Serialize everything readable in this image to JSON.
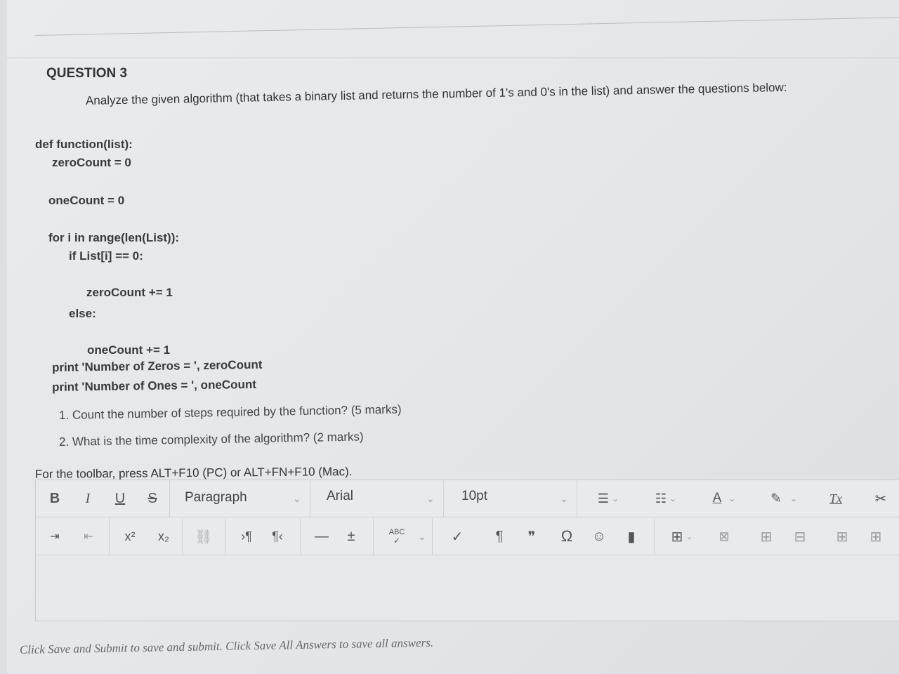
{
  "question": {
    "title": "QUESTION 3",
    "intro": "Analyze the given algorithm (that takes a binary list and returns the number of 1's and 0's in the list) and answer the questions below:"
  },
  "code": [
    "def function(list):",
    "zeroCount = 0",
    "oneCount = 0",
    "for i in range(len(List)):",
    "if List[i] == 0:",
    "zeroCount += 1",
    "else:",
    "oneCount += 1",
    "print 'Number of Zeros = ', zeroCount",
    "print 'Number of Ones = ', oneCount"
  ],
  "subquestions": [
    "1. Count the number of steps required by the function? (5 marks)",
    "2. What is the time complexity of the algorithm? (2 marks)"
  ],
  "editor": {
    "toolbar_hint": "For the toolbar, press ALT+F10 (PC) or ALT+FN+F10 (Mac).",
    "bold": "B",
    "italic": "I",
    "underline": "U",
    "strike": "S",
    "block_format": "Paragraph",
    "font_family": "Arial",
    "font_size": "10pt",
    "font_color_letter": "A",
    "clear_format": "Tx",
    "superscript": "x²",
    "subscript": "x₂",
    "spellcheck": "ABC",
    "paragraph_mark": "¶",
    "quote": "❞",
    "omega": "Ω",
    "icons": [
      "bullet-list",
      "numbered-list",
      "font-color",
      "highlight",
      "clear-formatting",
      "cut",
      "indent",
      "outdent",
      "superscript",
      "subscript",
      "unlink",
      "ltr",
      "rtl",
      "horizontal-line",
      "plus-minus",
      "spellcheck",
      "checkmark",
      "paragraph",
      "quote",
      "omega",
      "emoji",
      "bookmark",
      "table",
      "delete-table",
      "table-row",
      "table-col",
      "table-cell",
      "table-merge"
    ]
  },
  "footer": "Click Save and Submit to save and submit. Click Save All Answers to save all answers."
}
